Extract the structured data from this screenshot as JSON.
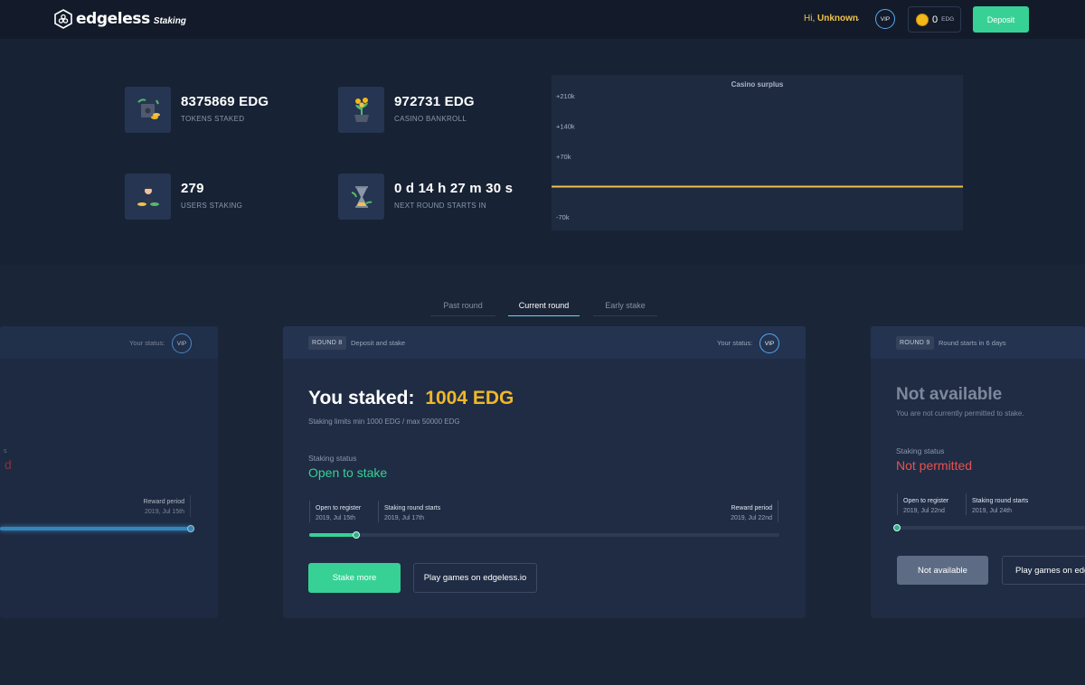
{
  "header": {
    "brand": "edgeless",
    "brand_sub": "Staking",
    "greeting_prefix": "Hi, ",
    "username": "Unknown",
    "vip": "VIP",
    "balance": "0",
    "balance_currency": "EDG",
    "deposit_label": "Deposit"
  },
  "stats": [
    {
      "value": "8375869 EDG",
      "label": "TOKENS STAKED",
      "icon": "safe-icon"
    },
    {
      "value": "972731 EDG",
      "label": "CASINO BANKROLL",
      "icon": "money-plant-icon"
    },
    {
      "value": "279",
      "label": "USERS STAKING",
      "icon": "user-icon"
    },
    {
      "value": "0 d 14 h 27 m 30 s",
      "label": "NEXT ROUND STARTS IN",
      "icon": "hourglass-icon"
    }
  ],
  "chart_data": {
    "type": "line",
    "title": "Casino surplus",
    "y_ticks": [
      "+210k",
      "+140k",
      "+70k",
      "-70k"
    ],
    "series": [
      {
        "values": [
          0,
          0
        ]
      }
    ],
    "ylim": [
      -70000,
      210000
    ],
    "color": "#f0c24a"
  },
  "tabs": [
    {
      "label": "Past round",
      "active": false
    },
    {
      "label": "Current round",
      "active": true
    },
    {
      "label": "Early stake",
      "active": false
    }
  ],
  "past_card": {
    "status_label": "Your status:",
    "vip": "VIP",
    "fragment_1": "s",
    "fragment_2": "d",
    "reward_label": "Reward period",
    "reward_date": "2019, Jul 15th"
  },
  "current_card": {
    "round_tag": "ROUND 8",
    "round_desc": "Deposit and stake",
    "status_label": "Your status:",
    "vip": "VIP",
    "staked_label": "You staked:",
    "staked_value": "1004 EDG",
    "limits": "Staking limits min 1000 EDG / max 50000 EDG",
    "staking_status_label": "Staking status",
    "staking_status": "Open to stake",
    "timeline": [
      {
        "label": "Open to register",
        "date": "2019, Jul 15th"
      },
      {
        "label": "Staking round starts",
        "date": "2019, Jul 17th"
      },
      {
        "label": "Reward period",
        "date": "2019, Jul 22nd"
      }
    ],
    "progress": 0.1,
    "stake_more": "Stake more",
    "play_games": "Play games on edgeless.io"
  },
  "next_card": {
    "round_tag": "ROUND 9",
    "round_desc": "Round starts in 6 days",
    "title": "Not available",
    "subtitle": "You are not currently permitted to stake.",
    "staking_status_label": "Staking status",
    "staking_status": "Not permitted",
    "timeline": [
      {
        "label": "Open to register",
        "date": "2019, Jul 22nd"
      },
      {
        "label": "Staking round starts",
        "date": "2019, Jul 24th"
      }
    ],
    "progress": 0,
    "not_available_btn": "Not available",
    "play_games": "Play games on edg"
  },
  "colors": {
    "accent_green": "#37d196",
    "accent_yellow": "#f0c24a",
    "danger": "#e9514f",
    "vip_blue": "#5aa8f0"
  }
}
